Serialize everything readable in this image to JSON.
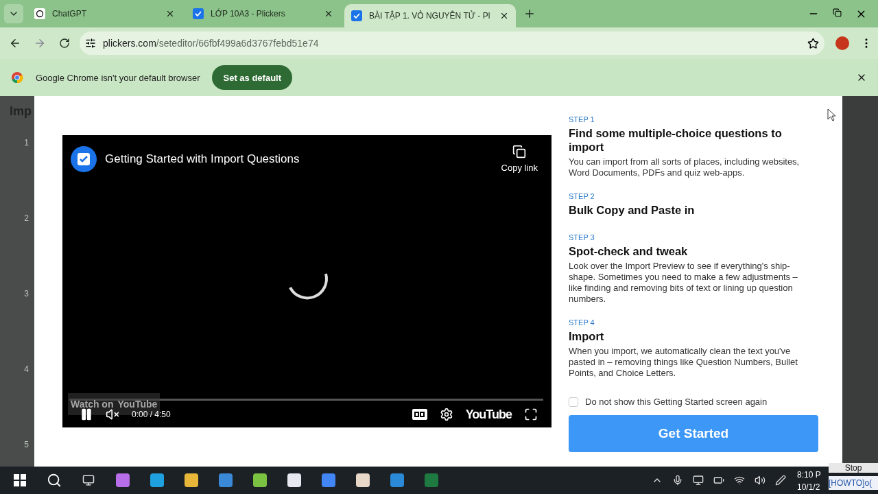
{
  "tabs": [
    {
      "label": "ChatGPT",
      "kind": "chatgpt",
      "selected": false
    },
    {
      "label": "LỚP 10A3 - Plickers",
      "kind": "plickers",
      "selected": false
    },
    {
      "label": "BÀI TẬP 1. VỎ NGUYÊN TỬ - Pl",
      "kind": "plickers",
      "selected": true
    }
  ],
  "address": {
    "domain": "plickers.com",
    "path": "/seteditor/66fbf499a6d3767febd51e74"
  },
  "infobar": {
    "message": "Google Chrome isn't your default browser",
    "button": "Set as default"
  },
  "backdrop": {
    "title": "Imp",
    "numbers": [
      "1",
      "2",
      "3",
      "4",
      "5"
    ]
  },
  "video": {
    "title": "Getting Started with Import Questions",
    "copy_link": "Copy link",
    "watch_on": "Watch on",
    "watch_brand": "YouTube",
    "time": "0:00 / 4:50",
    "brand": "YouTube"
  },
  "steps": [
    {
      "step": "STEP 1",
      "title": "Find some multiple-choice questions to import",
      "text": "You can import from all sorts of places, including websites, Word Documents, PDFs and quiz web-apps."
    },
    {
      "step": "STEP 2",
      "title": "Bulk Copy and Paste in"
    },
    {
      "step": "STEP 3",
      "title": "Spot-check and tweak",
      "text": "Look over the Import Preview to see if everything's ship-shape. Sometimes you need to make a few adjustments – like finding and removing bits of text or lining up question numbers."
    },
    {
      "step": "STEP 4",
      "title": "Import",
      "text": "When you import, we automatically clean the text you've pasted in – removing things like Question Numbers, Bullet Points, and Choice Letters."
    }
  ],
  "dont_show": {
    "label": "Do not show this Getting Started screen again",
    "checked": false
  },
  "get_started": "Get Started",
  "taskbar": {
    "time": "8:10 P",
    "date": "10/1/2",
    "overlay_stop": "Stop",
    "overlay_title": "[HOWTO]o("
  }
}
